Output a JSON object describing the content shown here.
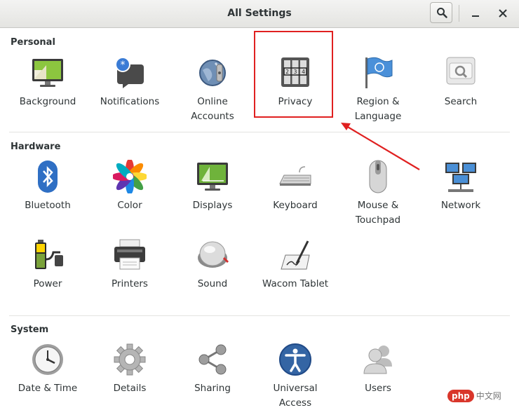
{
  "window": {
    "title": "All Settings"
  },
  "sections": {
    "personal": {
      "title": "Personal",
      "items": [
        {
          "label": "Background",
          "icon": "background-icon"
        },
        {
          "label": "Notifications",
          "icon": "notifications-icon"
        },
        {
          "label": "Online\nAccounts",
          "icon": "online-accounts-icon"
        },
        {
          "label": "Privacy",
          "icon": "privacy-icon"
        },
        {
          "label": "Region &\nLanguage",
          "icon": "region-language-icon"
        },
        {
          "label": "Search",
          "icon": "search-settings-icon"
        }
      ]
    },
    "hardware": {
      "title": "Hardware",
      "items": [
        {
          "label": "Bluetooth",
          "icon": "bluetooth-icon"
        },
        {
          "label": "Color",
          "icon": "color-icon"
        },
        {
          "label": "Displays",
          "icon": "displays-icon"
        },
        {
          "label": "Keyboard",
          "icon": "keyboard-icon"
        },
        {
          "label": "Mouse &\nTouchpad",
          "icon": "mouse-icon"
        },
        {
          "label": "Network",
          "icon": "network-icon"
        },
        {
          "label": "Power",
          "icon": "power-icon"
        },
        {
          "label": "Printers",
          "icon": "printer-icon"
        },
        {
          "label": "Sound",
          "icon": "sound-icon"
        },
        {
          "label": "Wacom Tablet",
          "icon": "wacom-icon"
        }
      ]
    },
    "system": {
      "title": "System",
      "items": [
        {
          "label": "Date & Time",
          "icon": "clock-icon"
        },
        {
          "label": "Details",
          "icon": "gear-icon"
        },
        {
          "label": "Sharing",
          "icon": "share-icon"
        },
        {
          "label": "Universal\nAccess",
          "icon": "accessibility-icon"
        },
        {
          "label": "Users",
          "icon": "users-icon"
        }
      ]
    }
  },
  "annotation": {
    "highlight_color": "#e02020",
    "highlighted_item": "Privacy"
  },
  "watermark": {
    "badge": "php",
    "text": "中文网"
  }
}
